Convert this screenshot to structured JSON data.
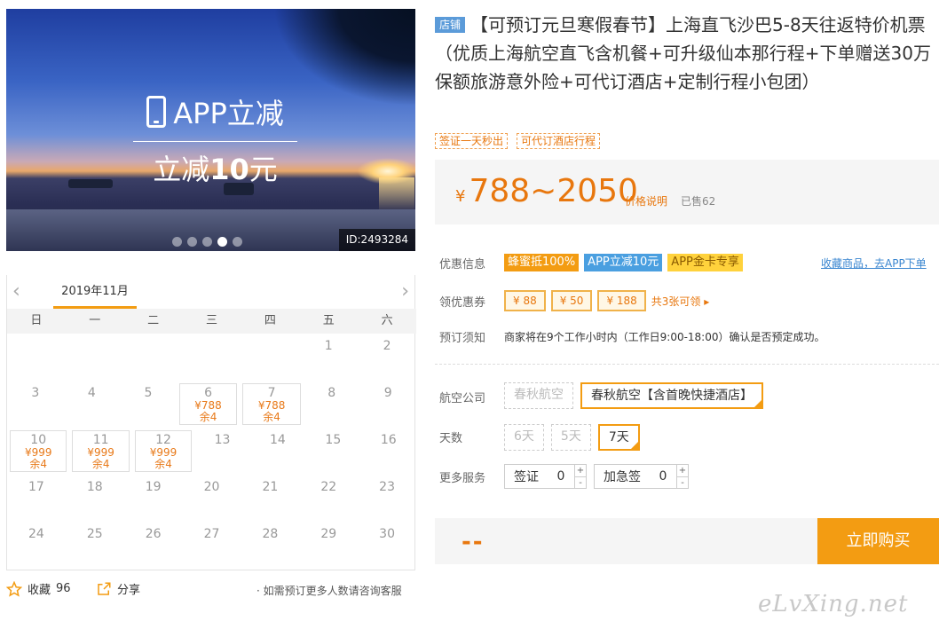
{
  "hero": {
    "promo_line1": "APP立减",
    "promo_prefix": "立减",
    "promo_amount": "10",
    "promo_suffix": "元",
    "product_id": "ID:2493284",
    "slides": 5,
    "active_slide": 4
  },
  "calendar": {
    "month": "2019年11月",
    "prev": "‹",
    "next": "›",
    "weekdays": [
      "日",
      "一",
      "二",
      "三",
      "四",
      "五",
      "六"
    ],
    "rows": [
      [
        {
          "d": ""
        },
        {
          "d": ""
        },
        {
          "d": ""
        },
        {
          "d": ""
        },
        {
          "d": ""
        },
        {
          "d": "1"
        },
        {
          "d": "2"
        }
      ],
      [
        {
          "d": "3"
        },
        {
          "d": "4"
        },
        {
          "d": "5"
        },
        {
          "d": "6",
          "p": "¥788",
          "r": "余4"
        },
        {
          "d": "7",
          "p": "¥788",
          "r": "余4"
        },
        {
          "d": "8"
        },
        {
          "d": "9"
        }
      ],
      [
        {
          "d": "10",
          "p": "¥999",
          "r": "余4"
        },
        {
          "d": "11",
          "p": "¥999",
          "r": "余4"
        },
        {
          "d": "12",
          "p": "¥999",
          "r": "余4"
        },
        {
          "d": "13"
        },
        {
          "d": "14"
        },
        {
          "d": "15"
        },
        {
          "d": "16"
        }
      ],
      [
        {
          "d": "17"
        },
        {
          "d": "18"
        },
        {
          "d": "19"
        },
        {
          "d": "20"
        },
        {
          "d": "21"
        },
        {
          "d": "22"
        },
        {
          "d": "23"
        }
      ],
      [
        {
          "d": "24"
        },
        {
          "d": "25"
        },
        {
          "d": "26"
        },
        {
          "d": "27"
        },
        {
          "d": "28"
        },
        {
          "d": "29"
        },
        {
          "d": "30"
        }
      ]
    ]
  },
  "bottom": {
    "fav_label": "收藏",
    "fav_count": "96",
    "share_label": "分享",
    "note": "· 如需预订更多人数请咨询客服"
  },
  "product": {
    "shop_tag": "店铺",
    "title": "【可预订元旦寒假春节】上海直飞沙巴5-8天往返特价机票（优质上海航空直飞含机餐+可升级仙本那行程+下单赠送30万保额旅游意外险+可代订酒店+定制行程小包团）",
    "tags": [
      "签证一天秒出",
      "可代订酒店行程"
    ],
    "price_symbol": "¥",
    "price": "788~2050",
    "price_explain": "价格说明",
    "sold": "已售62"
  },
  "discount": {
    "label": "优惠信息",
    "badges": [
      "蜂蜜抵100%",
      "APP立减10元",
      "APP金卡专享"
    ],
    "fav_link": "收藏商品，去APP下单"
  },
  "coupons": {
    "label": "领优惠券",
    "items": [
      "¥ 88",
      "¥ 50",
      "¥ 188"
    ],
    "more": "共3张可领 ▸"
  },
  "notice": {
    "label": "预订须知",
    "text": "商家将在9个工作小时内（工作日9:00-18:00）确认是否预定成功。"
  },
  "airline": {
    "label": "航空公司",
    "options": [
      "春秋航空",
      "春秋航空【含首晚快捷酒店】"
    ]
  },
  "days": {
    "label": "天数",
    "options": [
      "6天",
      "5天",
      "7天"
    ]
  },
  "services": {
    "label": "更多服务",
    "items": [
      {
        "name": "签证",
        "value": "0"
      },
      {
        "name": "加急签",
        "value": "0"
      }
    ],
    "plus": "+",
    "minus": "-"
  },
  "buy": {
    "total": "--",
    "button": "立即购买"
  },
  "watermark": "eLvXing.net",
  "colors": {
    "accent": "#f39c12",
    "price": "#e8770e",
    "link": "#3a86d0"
  }
}
